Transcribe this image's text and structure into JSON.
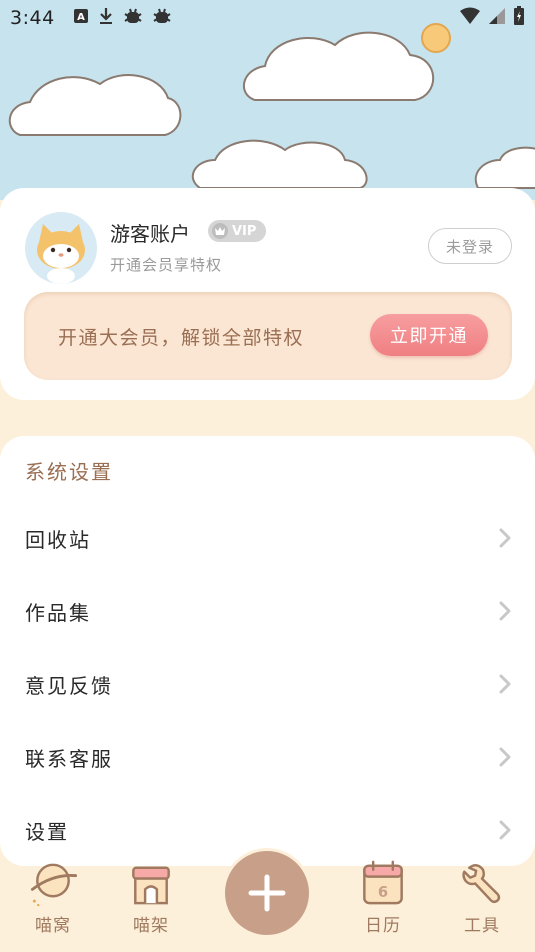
{
  "status_bar": {
    "time": "3:44",
    "icons": [
      "a-box-icon",
      "download-icon",
      "bug-icon",
      "bug-icon",
      "wifi-icon",
      "signal-icon",
      "battery-charging-icon"
    ]
  },
  "profile": {
    "username": "游客账户",
    "vip_badge": "VIP",
    "subtitle": "开通会员享特权",
    "login_button": "未登录"
  },
  "vip_banner": {
    "text": "开通大会员，解锁全部特权",
    "button": "立即开通"
  },
  "settings": {
    "title": "系统设置",
    "items": [
      {
        "label": "回收站"
      },
      {
        "label": "作品集"
      },
      {
        "label": "意见反馈"
      },
      {
        "label": "联系客服"
      },
      {
        "label": "设置"
      }
    ]
  },
  "bottom_nav": {
    "items": [
      {
        "label": "喵窝",
        "icon": "planet-icon"
      },
      {
        "label": "喵架",
        "icon": "shop-icon"
      },
      {
        "label": "",
        "icon": "plus-icon"
      },
      {
        "label": "日历",
        "icon": "calendar-icon",
        "calendar_day": "6"
      },
      {
        "label": "工具",
        "icon": "wrench-icon"
      }
    ]
  },
  "colors": {
    "sky": "#c6e3ee",
    "background": "#fdf0da",
    "accent_brown": "#9a6e52",
    "button_pink": "#ef7f82",
    "add_button": "#c8a08a"
  }
}
